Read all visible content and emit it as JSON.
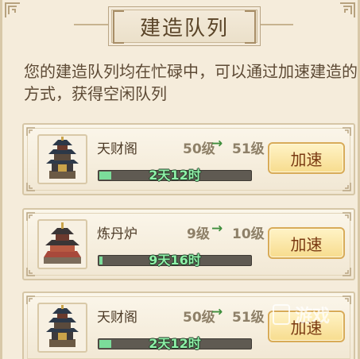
{
  "title": "建造队列",
  "description": "您的建造队列均在忙碌中，可以通过加速建造的方式，获得空闲队列",
  "arrow_glyph": "→",
  "queue": [
    {
      "name": "天财阁",
      "level_from": "50级",
      "level_to": "51级",
      "time": "2天12时",
      "progress": 0.09,
      "button": "加速",
      "icon": "tower-pagoda-icon"
    },
    {
      "name": "炼丹炉",
      "level_from": "9级",
      "level_to": "10级",
      "time": "9天16时",
      "progress": 0.03,
      "button": "加速",
      "icon": "alchemy-furnace-icon"
    },
    {
      "name": "天财阁",
      "level_from": "50级",
      "level_to": "51级",
      "time": "2天12时",
      "progress": 0.09,
      "button": "加速",
      "icon": "tower-pagoda-icon"
    }
  ],
  "watermark": "游戏",
  "colors": {
    "background": "#f5ecdb",
    "progress_fill": "#7bdc9a",
    "button_text": "#7a3a12",
    "arrow": "#3f8e3c"
  }
}
